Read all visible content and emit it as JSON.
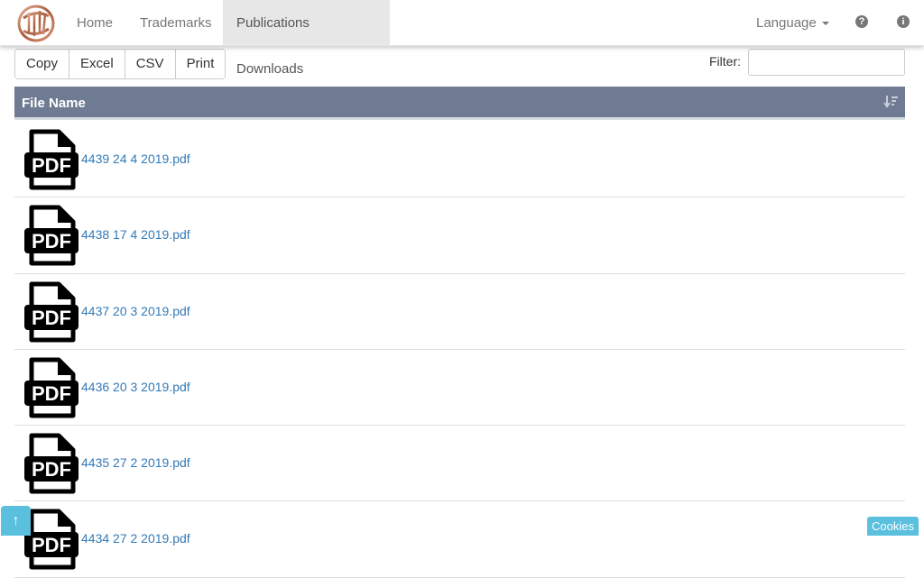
{
  "navbar": {
    "items": [
      {
        "label": "Home"
      },
      {
        "label": "Trademarks"
      },
      {
        "label": "Publications Downloads",
        "active": true
      }
    ],
    "language_label": "Language",
    "help_icon": "question-circle-icon",
    "info_icon": "info-circle-icon"
  },
  "toolbar": {
    "buttons": [
      {
        "label": "Copy"
      },
      {
        "label": "Excel"
      },
      {
        "label": "CSV"
      },
      {
        "label": "Print"
      }
    ],
    "filter_label": "Filter:",
    "filter_value": ""
  },
  "table": {
    "header": "File Name",
    "rows": [
      {
        "file": "4439 24 4 2019.pdf"
      },
      {
        "file": "4438 17 4 2019.pdf"
      },
      {
        "file": "4437 20 3 2019.pdf"
      },
      {
        "file": "4436 20 3 2019.pdf"
      },
      {
        "file": "4435 27 2 2019.pdf"
      },
      {
        "file": "4434 27 2 2019.pdf"
      }
    ]
  },
  "scroll_top_label": "↑",
  "cookies_label": "Cookies",
  "colors": {
    "header_bg": "#6e7b93",
    "link": "#337ab7",
    "accent_button": "#5bc0de"
  }
}
